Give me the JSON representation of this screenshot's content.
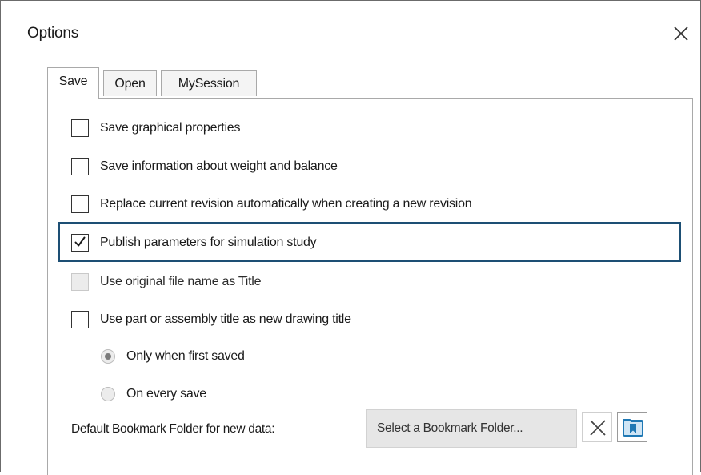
{
  "dialog": {
    "title": "Options",
    "close_icon": "close-icon"
  },
  "tabs": [
    {
      "label": "Save",
      "active": true
    },
    {
      "label": "Open",
      "active": false
    },
    {
      "label": "MySession",
      "active": false
    }
  ],
  "options": [
    {
      "label": "Save graphical properties",
      "checked": false,
      "enabled": true
    },
    {
      "label": "Save information about weight and balance",
      "checked": false,
      "enabled": true
    },
    {
      "label": "Replace current revision automatically when creating a new revision",
      "checked": false,
      "enabled": true
    },
    {
      "label": "Publish parameters for simulation study",
      "checked": true,
      "enabled": true,
      "highlighted": true
    },
    {
      "label": "Use original file name as Title",
      "checked": false,
      "enabled": false
    },
    {
      "label": "Use part or assembly title as new drawing title",
      "checked": false,
      "enabled": true
    }
  ],
  "title_radio": [
    {
      "label": "Only when first saved",
      "selected": true,
      "enabled": false
    },
    {
      "label": "On every save",
      "selected": false,
      "enabled": false
    }
  ],
  "bookmark": {
    "label": "Default Bookmark Folder for new data:",
    "placeholder": "Select a Bookmark Folder...",
    "clear_icon": "clear-icon",
    "browse_icon": "bookmark-folder-icon"
  },
  "colors": {
    "highlight_border": "#1d4f74",
    "bookmark_icon": "#1f78b4"
  }
}
